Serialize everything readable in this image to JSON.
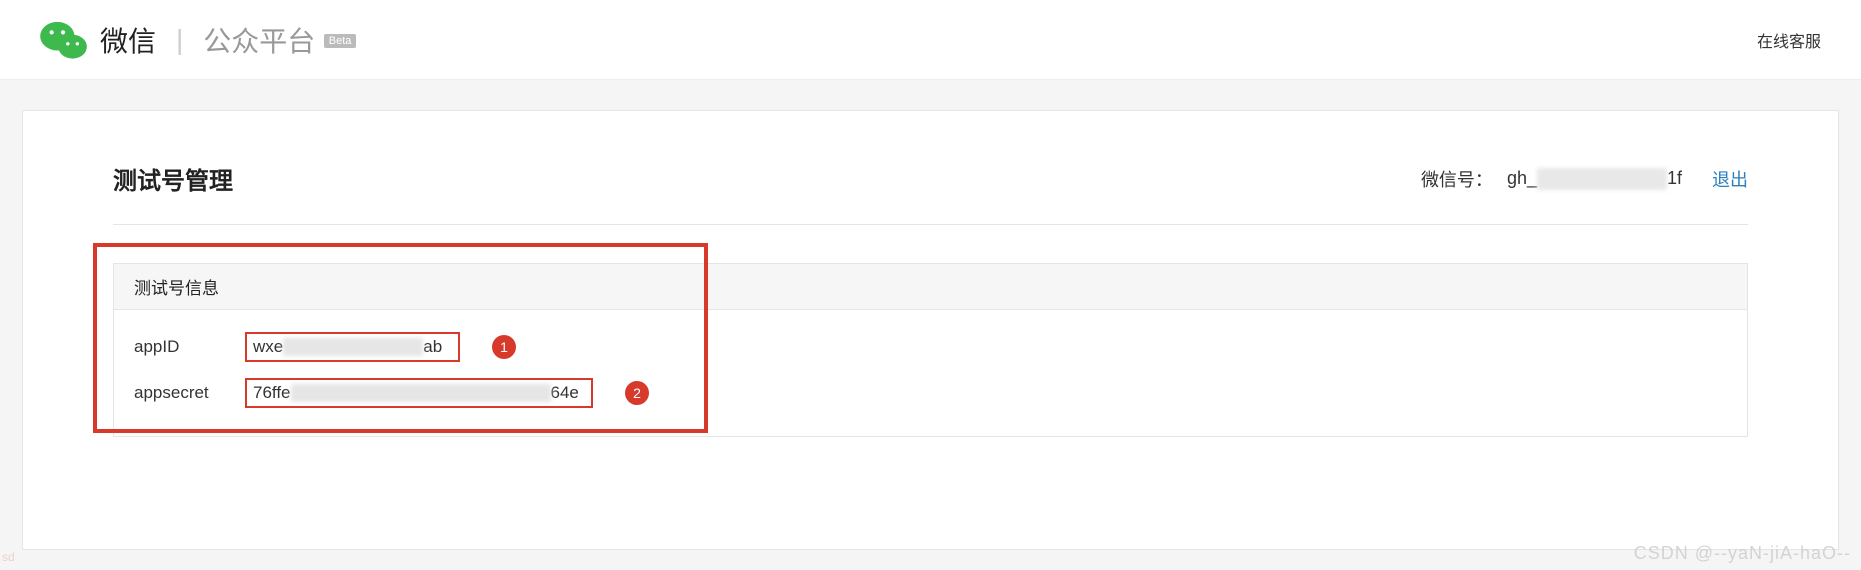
{
  "header": {
    "brand_weixin": "微信",
    "brand_platform": "公众平台",
    "beta": "Beta",
    "customer_service": "在线客服"
  },
  "page": {
    "title": "测试号管理",
    "account_label": "微信号：",
    "account_prefix": "gh_",
    "account_suffix": "1f",
    "logout": "退出"
  },
  "info": {
    "section_title": "测试号信息",
    "rows": [
      {
        "key": "appID",
        "val_prefix": "wxe",
        "val_suffix": "ab",
        "badge": "1"
      },
      {
        "key": "appsecret",
        "val_prefix": "76ffe",
        "val_suffix": "64e",
        "badge": "2"
      }
    ]
  },
  "watermark": "CSDN @--yaN-jiA-haO--",
  "side_watermark": "sd"
}
